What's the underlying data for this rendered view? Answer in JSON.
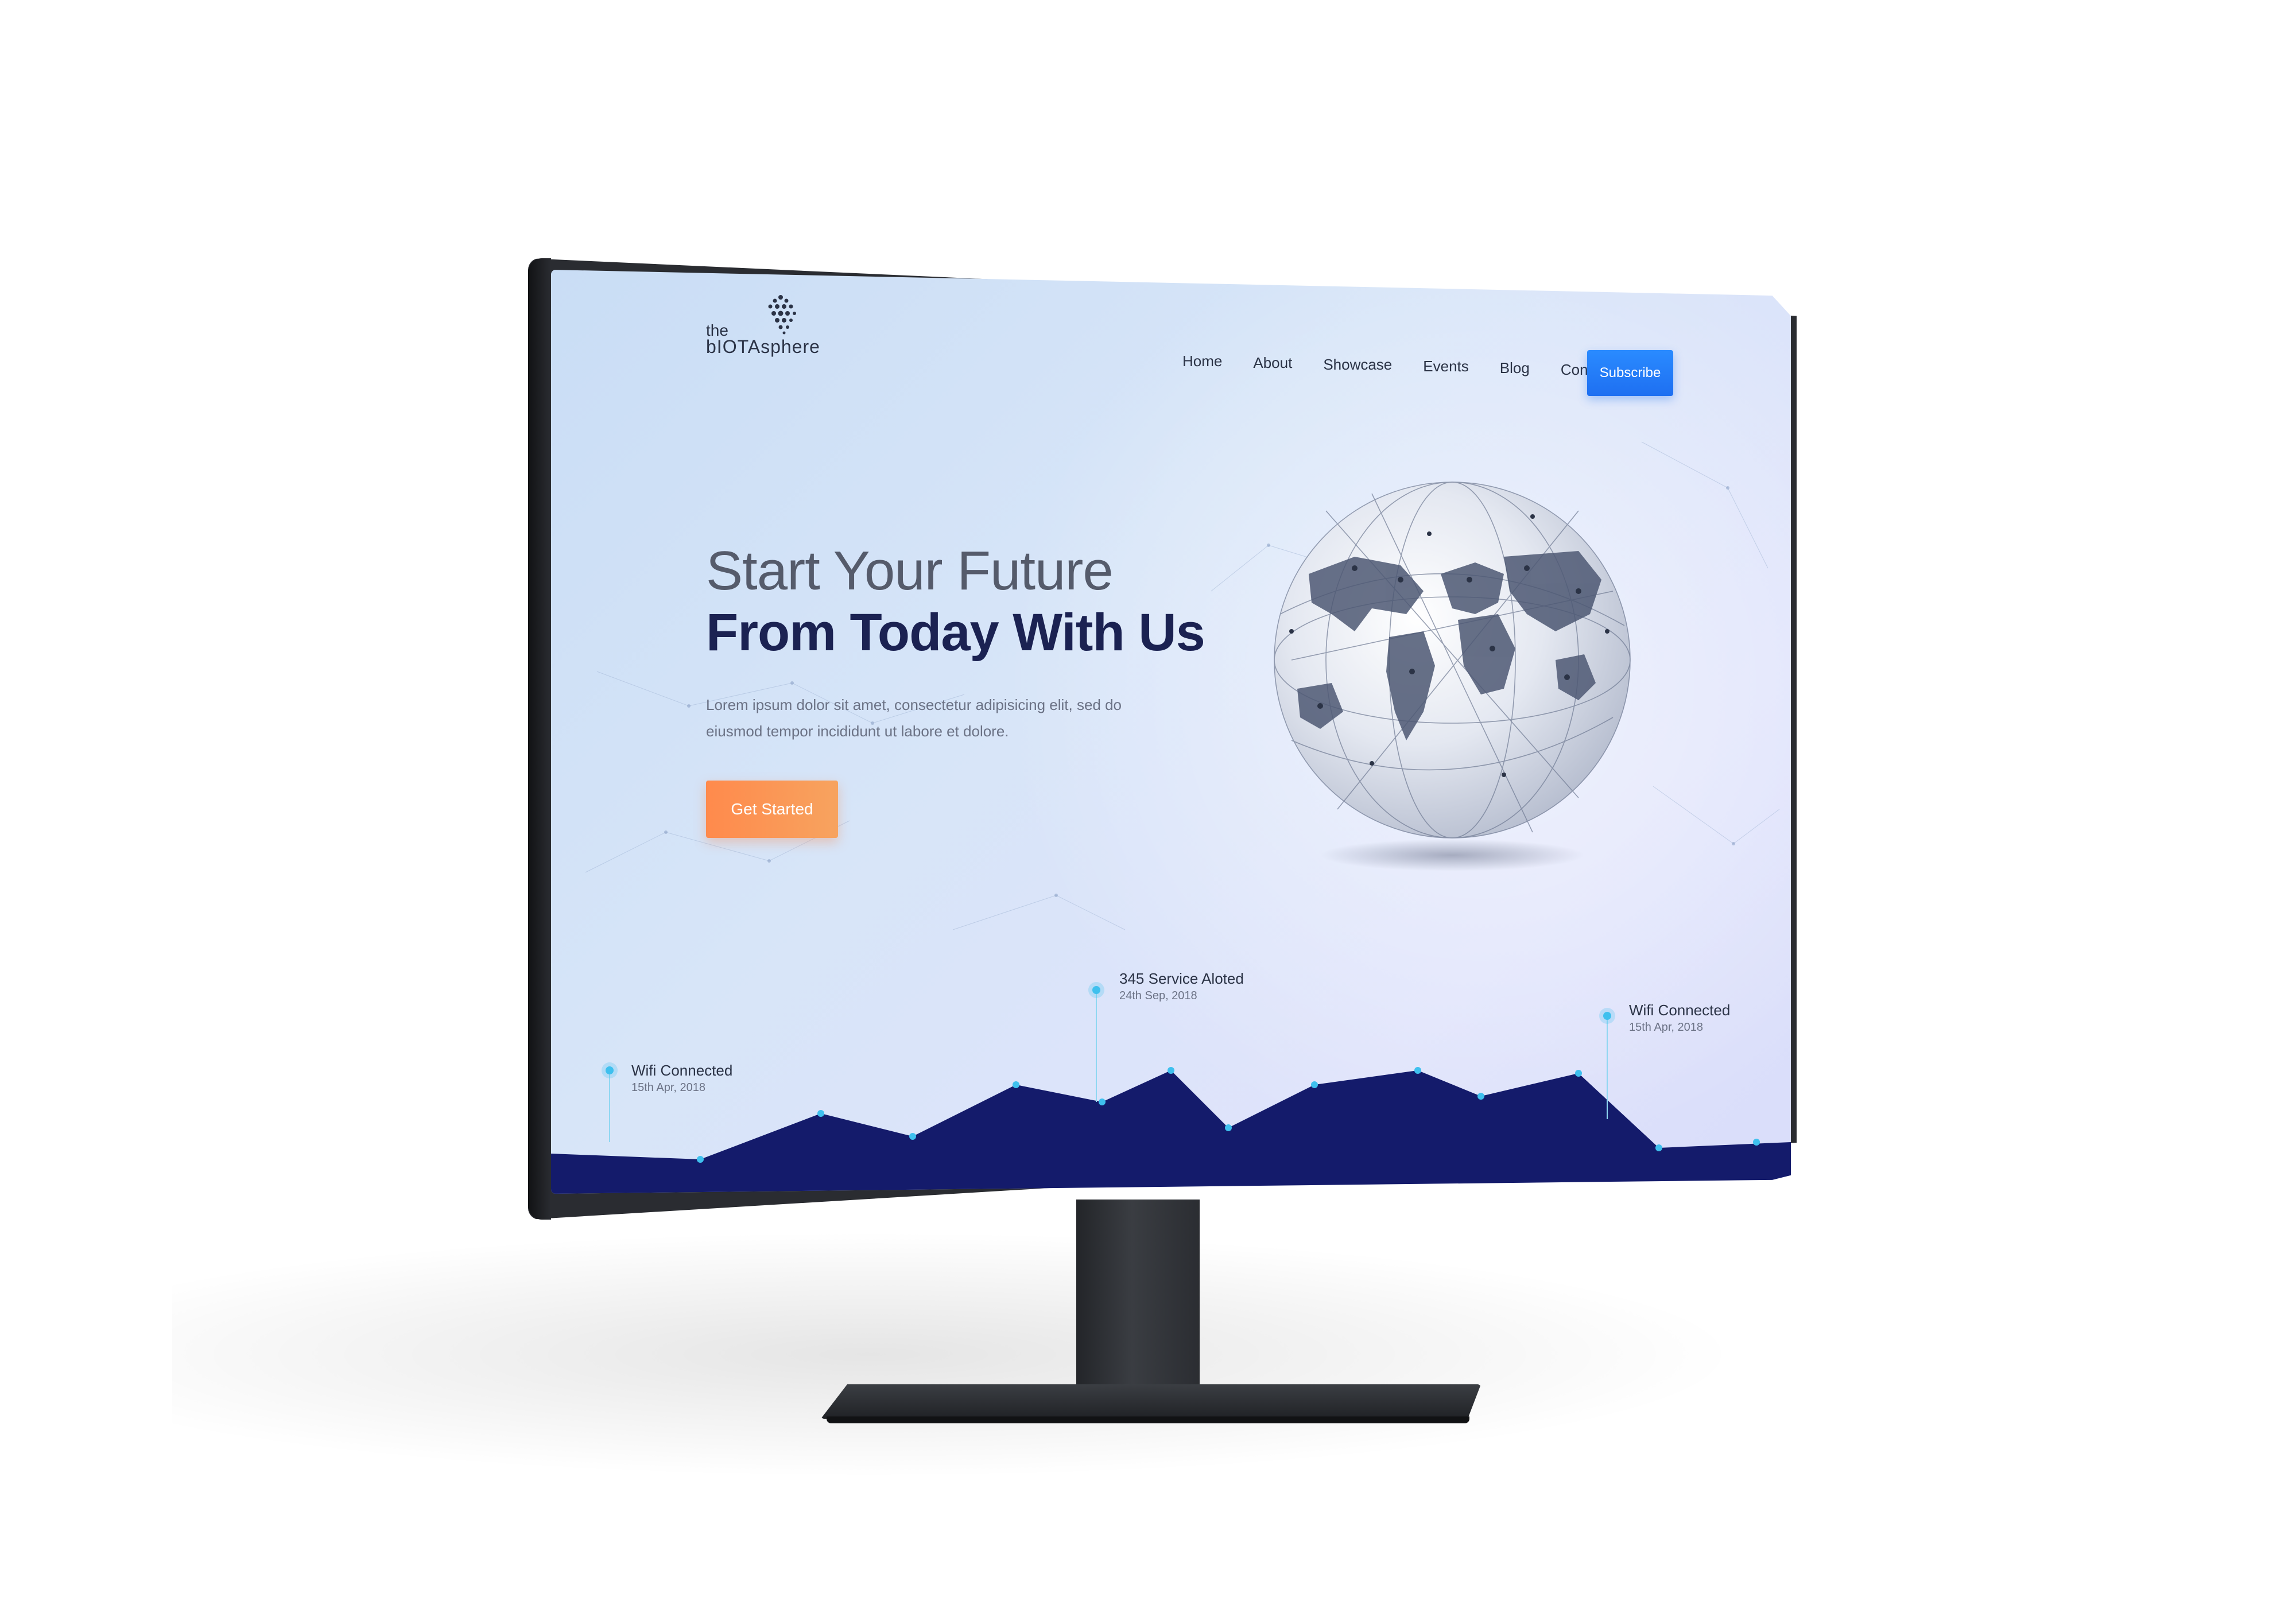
{
  "brand": {
    "logo_prefix": "the",
    "logo_name": "bIOTAsphere",
    "logo_icon": "iota-dots-icon"
  },
  "nav": {
    "items": [
      "Home",
      "About",
      "Showcase",
      "Events",
      "Blog",
      "Contact"
    ],
    "subscribe_label": "Subscribe"
  },
  "hero": {
    "line1": "Start Your Future",
    "line2": "From Today With Us",
    "description": "Lorem ipsum dolor sit amet, consectetur adipisicing elit, sed do eiusmod tempor incididunt ut labore et dolore.",
    "cta_label": "Get Started"
  },
  "events": [
    {
      "title": "Wifi Connected",
      "date": "15th Apr, 2018"
    },
    {
      "title": "345 Service Aloted",
      "date": "24th Sep, 2018"
    },
    {
      "title": "Wifi Connected",
      "date": "15th Apr, 2018"
    }
  ],
  "colors": {
    "accent_blue": "#1e6ff1",
    "cta_orange": "#ff8a4c",
    "heading_navy": "#1b2252",
    "chart_fill": "#141b6b",
    "chart_point": "#3fc0ee"
  },
  "globe_icon": "world-network-globe"
}
